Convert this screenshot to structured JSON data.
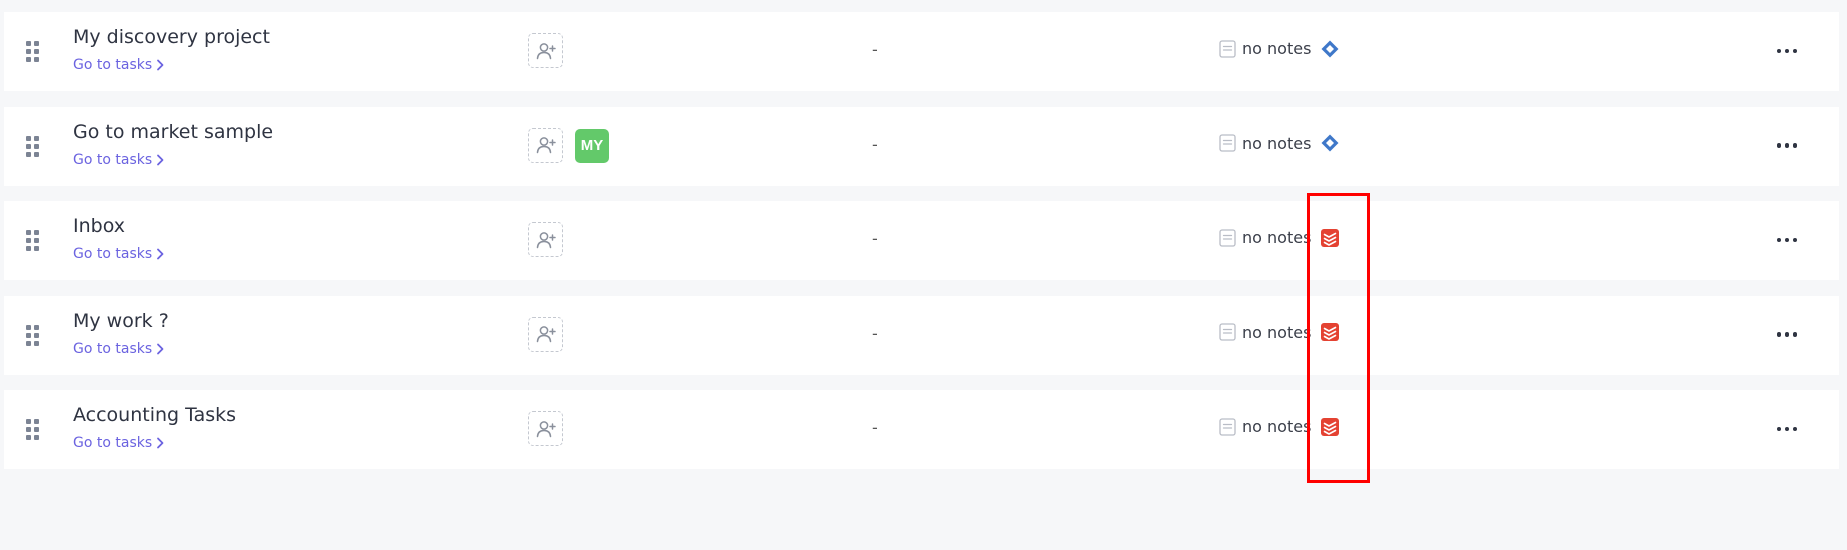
{
  "projects": [
    {
      "name": "My discovery project",
      "goto_label": "Go to tasks",
      "assignee": "",
      "date": "-",
      "notes": "no notes",
      "source_icon": "diamond-icon",
      "source_color": "#3f78c9"
    },
    {
      "name": "Go to market sample",
      "goto_label": "Go to tasks",
      "assignee": "MY",
      "assignee_color": "#63c96a",
      "date": "-",
      "notes": "no notes",
      "source_icon": "diamond-icon",
      "source_color": "#3f78c9"
    },
    {
      "name": "Inbox",
      "goto_label": "Go to tasks",
      "assignee": "",
      "date": "-",
      "notes": "no notes",
      "source_icon": "todoist-icon",
      "source_color": "#e44232"
    },
    {
      "name": "My work ?",
      "goto_label": "Go to tasks",
      "assignee": "",
      "date": "-",
      "notes": "no notes",
      "source_icon": "todoist-icon",
      "source_color": "#e44232"
    },
    {
      "name": "Accounting Tasks",
      "goto_label": "Go to tasks",
      "assignee": "",
      "date": "-",
      "notes": "no notes",
      "source_icon": "todoist-icon",
      "source_color": "#e44232"
    }
  ],
  "colors": {
    "link": "#6b63e0",
    "highlight": "#ff0000",
    "background": "#f6f7f9"
  }
}
